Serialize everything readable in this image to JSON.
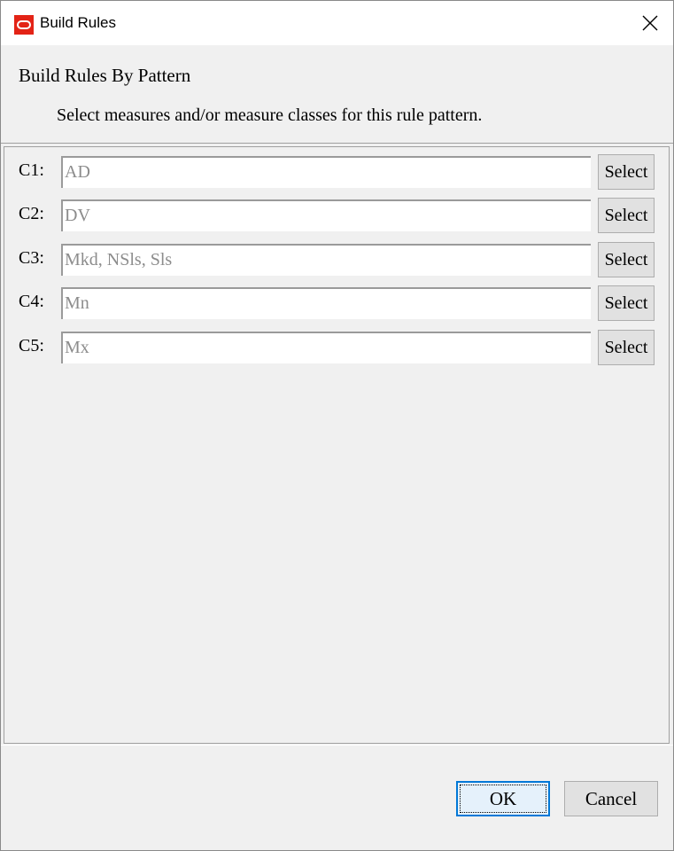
{
  "window": {
    "title": "Build Rules",
    "app_icon": "oracle-icon",
    "close_icon": "close-icon"
  },
  "header": {
    "title": "Build Rules By Pattern",
    "description": "Select measures and/or measure classes for this rule pattern."
  },
  "rows": [
    {
      "label": "C1:",
      "value": "AD",
      "button": "Select"
    },
    {
      "label": "C2:",
      "value": "DV",
      "button": "Select"
    },
    {
      "label": "C3:",
      "value": "Mkd, NSls, Sls",
      "button": "Select"
    },
    {
      "label": "C4:",
      "value": "Mn",
      "button": "Select"
    },
    {
      "label": "C5:",
      "value": "Mx",
      "button": "Select"
    }
  ],
  "footer": {
    "ok_label": "OK",
    "cancel_label": "Cancel"
  },
  "colors": {
    "accent": "#0078d7",
    "brand": "#e32316",
    "field_text": "#8c8c8c"
  }
}
